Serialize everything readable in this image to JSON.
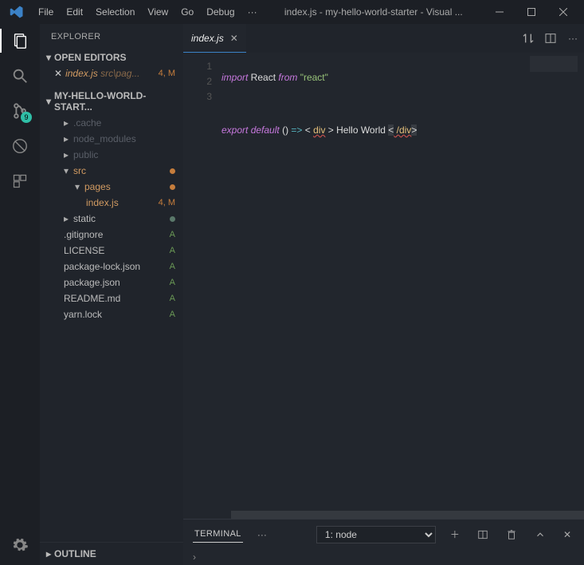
{
  "window_title": "index.js - my-hello-world-starter - Visual ...",
  "menu": [
    "File",
    "Edit",
    "Selection",
    "View",
    "Go",
    "Debug"
  ],
  "explorer_label": "EXPLORER",
  "open_editors_label": "OPEN EDITORS",
  "open_editor": {
    "name": "index.js",
    "path": "src\\pag...",
    "status": "4, M"
  },
  "project_label": "MY-HELLO-WORLD-START...",
  "outline_label": "OUTLINE",
  "scm_badge": "9",
  "tree": {
    "cache": ".cache",
    "nm": "node_modules",
    "public": "public",
    "src": "src",
    "pages": "pages",
    "indexjs": "index.js",
    "index_stat": "4, M",
    "static": "static",
    "gitignore": ".gitignore",
    "license": "LICENSE",
    "plock": "package-lock.json",
    "pkg": "package.json",
    "readme": "README.md",
    "yarn": "yarn.lock"
  },
  "tab_name": "index.js",
  "code": {
    "l1_import": "import",
    "l1_react": " React ",
    "l1_from": "from",
    "l1_str": " \"react\"",
    "l2": "",
    "l3_export": "export",
    "l3_default": " default",
    "l3_fn": " () ",
    "l3_arrow": "=>",
    "l3_open": " < ",
    "l3_tag": "div",
    "l3_gt": " > ",
    "l3_txt": "Hello World ",
    "l3_lt2": "<",
    "l3_close": " /div",
    "l3_gt2": ">"
  },
  "line_nums": {
    "1": "1",
    "2": "2",
    "3": "3"
  },
  "terminal_label": "TERMINAL",
  "terminal_select": "1: node"
}
